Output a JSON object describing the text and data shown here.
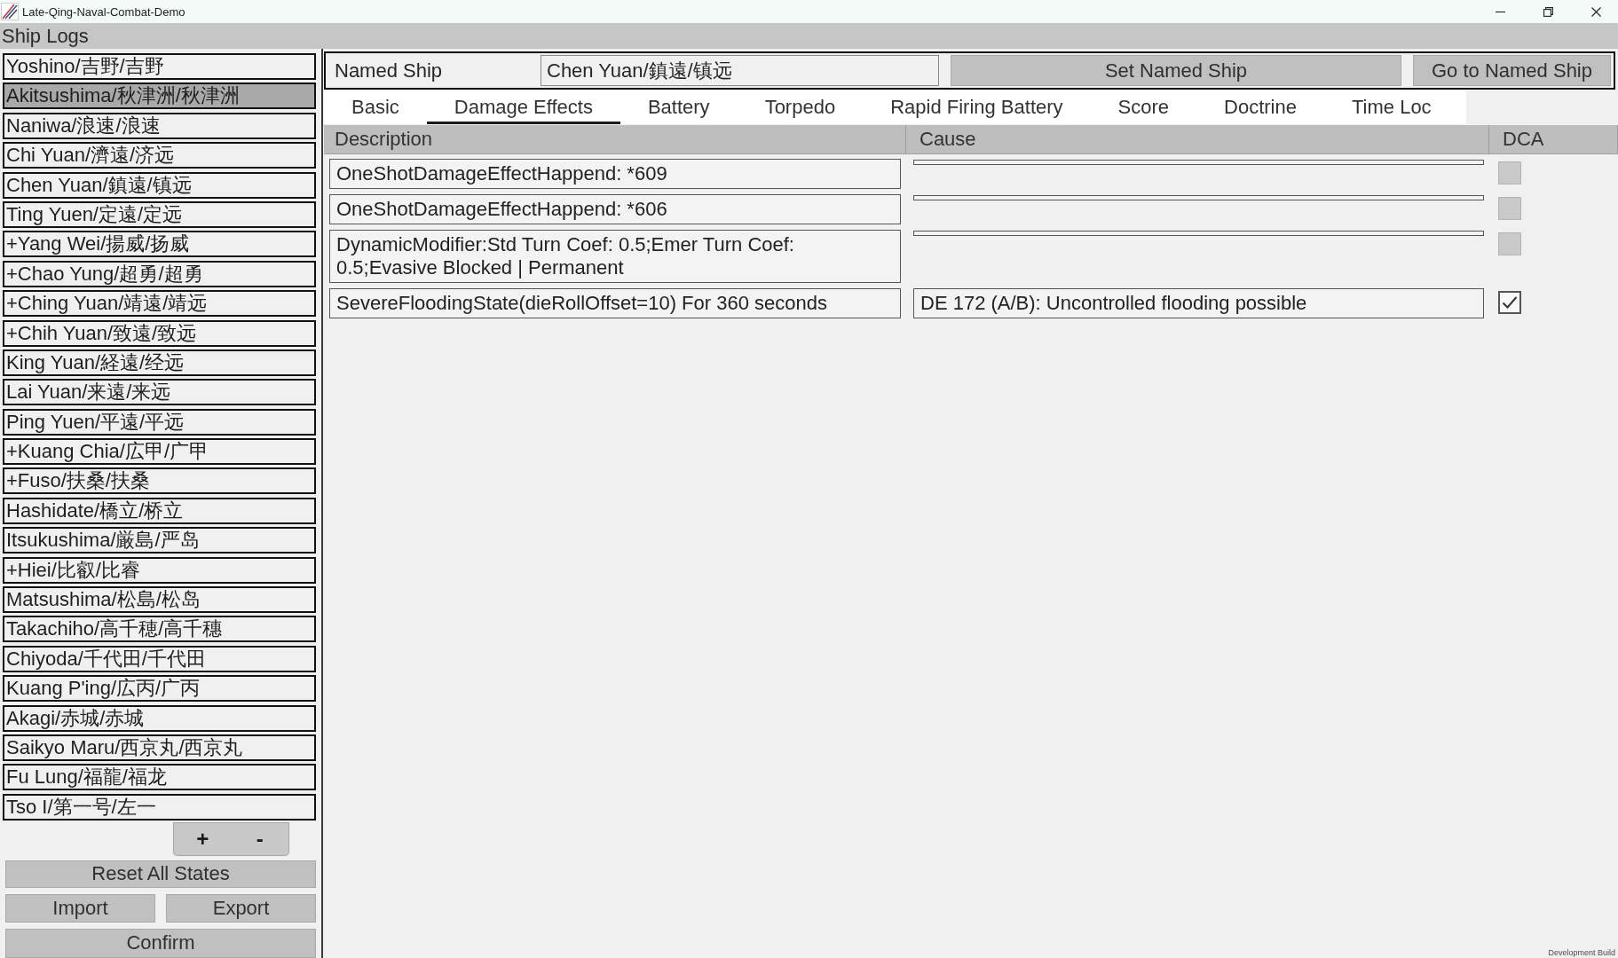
{
  "window": {
    "title": "Late-Qing-Naval-Combat-Demo"
  },
  "header": {
    "title": "Ship Logs"
  },
  "ship_list": {
    "items": [
      {
        "label": "Yoshino/吉野/吉野",
        "selected": false
      },
      {
        "label": "Akitsushima/秋津洲/秋津洲",
        "selected": true
      },
      {
        "label": "Naniwa/浪速/浪速",
        "selected": false
      },
      {
        "label": "Chi Yuan/濟遠/济远",
        "selected": false
      },
      {
        "label": "Chen Yuan/鎮遠/镇远",
        "selected": false
      },
      {
        "label": "Ting Yuen/定遠/定远",
        "selected": false
      },
      {
        "label": "+Yang Wei/揚威/扬威",
        "selected": false
      },
      {
        "label": "+Chao Yung/超勇/超勇",
        "selected": false
      },
      {
        "label": "+Ching Yuan/靖遠/靖远",
        "selected": false
      },
      {
        "label": "+Chih Yuan/致遠/致远",
        "selected": false
      },
      {
        "label": "King Yuan/経遠/经远",
        "selected": false
      },
      {
        "label": "Lai Yuan/来遠/来远",
        "selected": false
      },
      {
        "label": "Ping Yuen/平遠/平远",
        "selected": false
      },
      {
        "label": "+Kuang Chia/広甲/广甲",
        "selected": false
      },
      {
        "label": "+Fuso/扶桑/扶桑",
        "selected": false
      },
      {
        "label": "Hashidate/橋立/桥立",
        "selected": false
      },
      {
        "label": "Itsukushima/厳島/严岛",
        "selected": false
      },
      {
        "label": "+Hiei/比叡/比睿",
        "selected": false
      },
      {
        "label": "Matsushima/松島/松岛",
        "selected": false
      },
      {
        "label": "Takachiho/高千穂/高千穗",
        "selected": false
      },
      {
        "label": "Chiyoda/千代田/千代田",
        "selected": false
      },
      {
        "label": "Kuang P'ing/広丙/广丙",
        "selected": false
      },
      {
        "label": "Akagi/赤城/赤城",
        "selected": false
      },
      {
        "label": "Saikyo Maru/西京丸/西京丸",
        "selected": false
      },
      {
        "label": "Fu Lung/福龍/福龙",
        "selected": false
      },
      {
        "label": "Tso I/第一号/左一",
        "selected": false
      }
    ],
    "add_button": "+",
    "remove_button": "-"
  },
  "actions": {
    "reset": "Reset All States",
    "import": "Import",
    "export": "Export",
    "confirm": "Confirm"
  },
  "named_ship": {
    "label": "Named Ship",
    "value": "Chen Yuan/鎮遠/镇远",
    "set_button": "Set Named Ship",
    "goto_button": "Go to Named Ship"
  },
  "tabs": [
    {
      "label": "Basic",
      "selected": false
    },
    {
      "label": "Damage Effects",
      "selected": true
    },
    {
      "label": "Battery",
      "selected": false
    },
    {
      "label": "Torpedo",
      "selected": false
    },
    {
      "label": "Rapid Firing Battery",
      "selected": false
    },
    {
      "label": "Score",
      "selected": false
    },
    {
      "label": "Doctrine",
      "selected": false
    },
    {
      "label": "Time Loc",
      "selected": false
    }
  ],
  "table": {
    "columns": [
      "Description",
      "Cause",
      "DCA"
    ],
    "rows": [
      {
        "description": "OneShotDamageEffectHappend: *609",
        "checked": false
      },
      {
        "description": "OneShotDamageEffectHappend: *606",
        "checked": false
      },
      {
        "description": "DynamicModifier:Std Turn Coef: 0.5;Emer Turn Coef: 0.5;Evasive Blocked | Permanent",
        "checked": false
      },
      {
        "description": "SevereFloodingState(dieRollOffset=10) For 360 seconds",
        "cause": "DE 172 (A/B): Uncontrolled flooding possible",
        "checked": true
      }
    ]
  },
  "build_label": "Development Build"
}
